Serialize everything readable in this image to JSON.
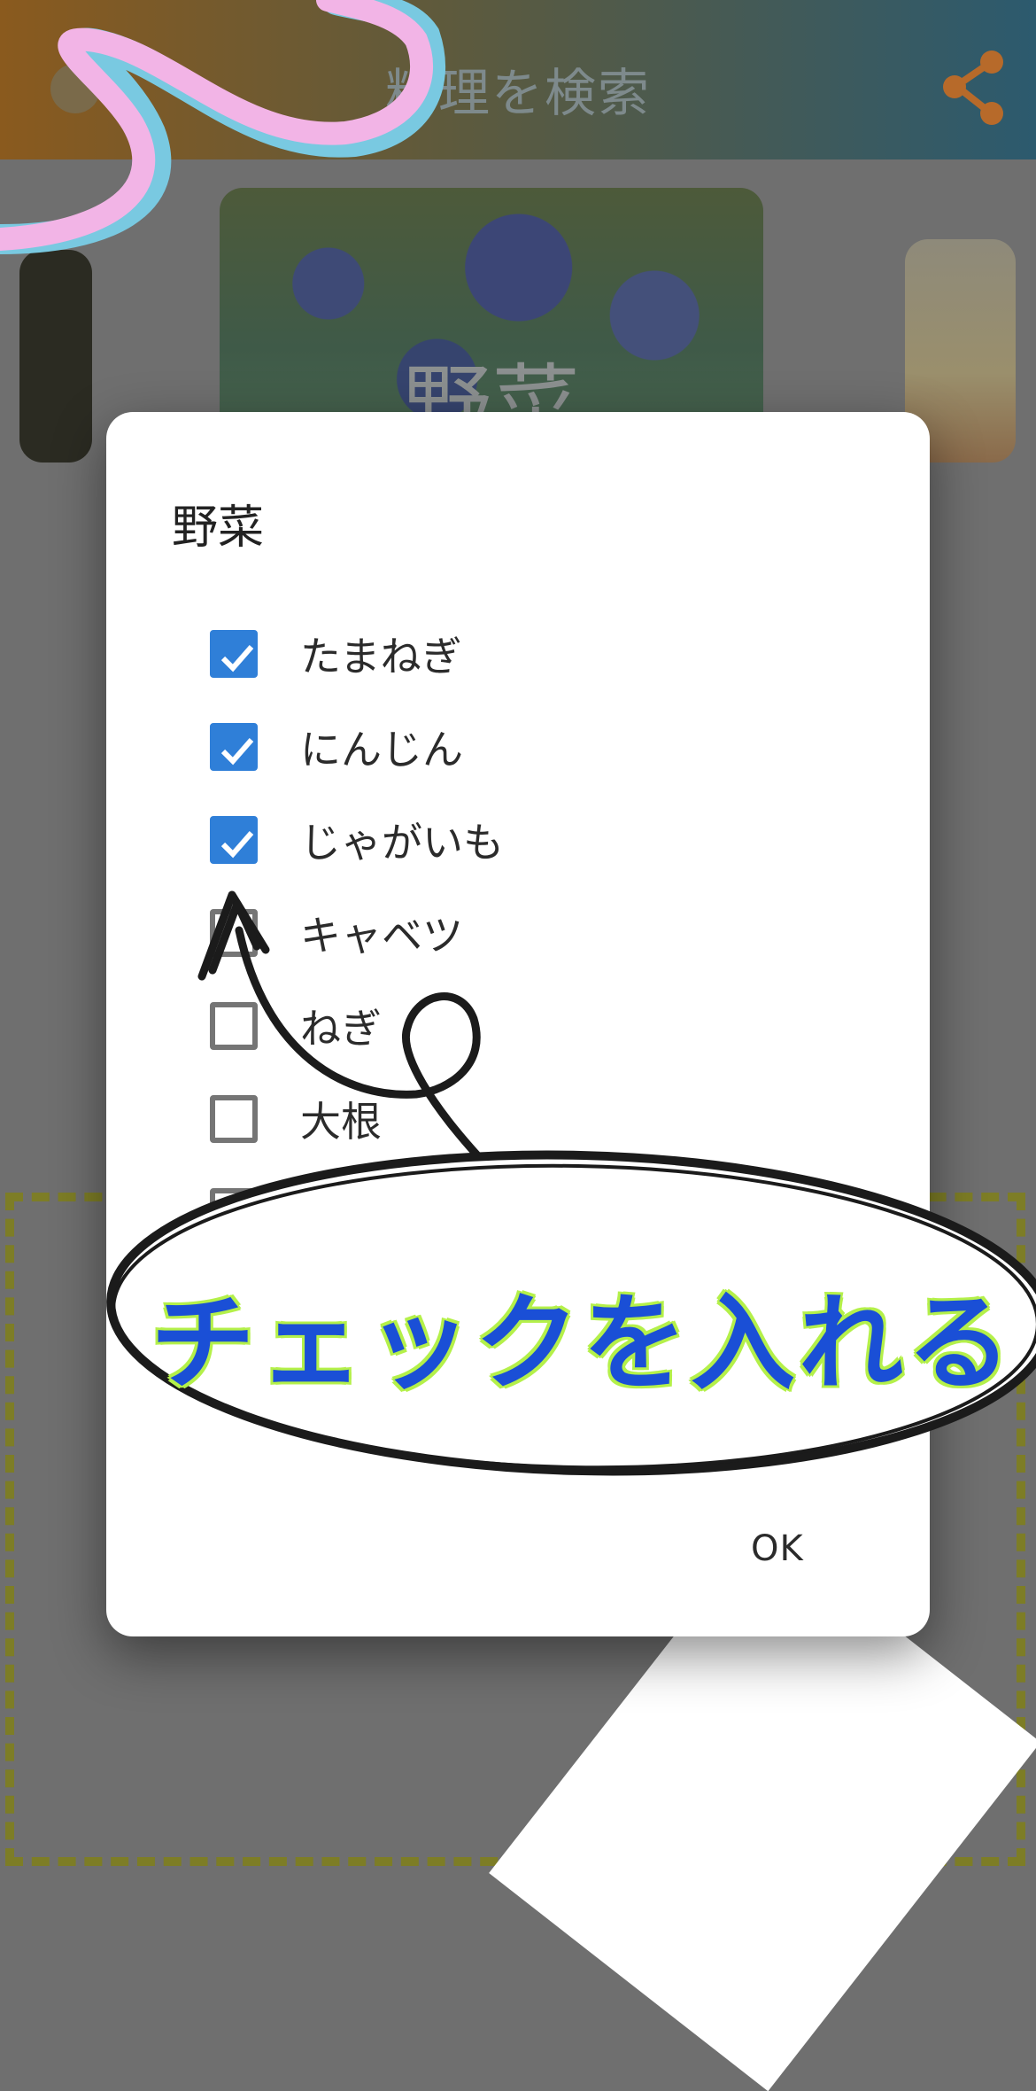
{
  "appbar": {
    "title": "料理を検索",
    "share_icon": "share-icon",
    "menu_icon": "menu-icon"
  },
  "cards": {
    "center_label": "野菜"
  },
  "dialog": {
    "title": "野菜",
    "options": [
      {
        "label": "たまねぎ",
        "checked": true
      },
      {
        "label": "にんじん",
        "checked": true
      },
      {
        "label": "じゃがいも",
        "checked": true
      },
      {
        "label": "キャベツ",
        "checked": false
      },
      {
        "label": "ねぎ",
        "checked": false
      },
      {
        "label": "大根",
        "checked": false
      },
      {
        "label": "",
        "checked": false
      }
    ],
    "ok_label": "OK"
  },
  "annotation": {
    "callout_text": "チェックを入れる"
  },
  "colors": {
    "checkbox_checked": "#2f7fd8",
    "callout_text": "#1a4fd6",
    "callout_outline": "#b4f04a",
    "ribbon_pink": "#f2b4e6",
    "ribbon_blue": "#79c9e1",
    "dashed_frame": "#7d7d26"
  }
}
